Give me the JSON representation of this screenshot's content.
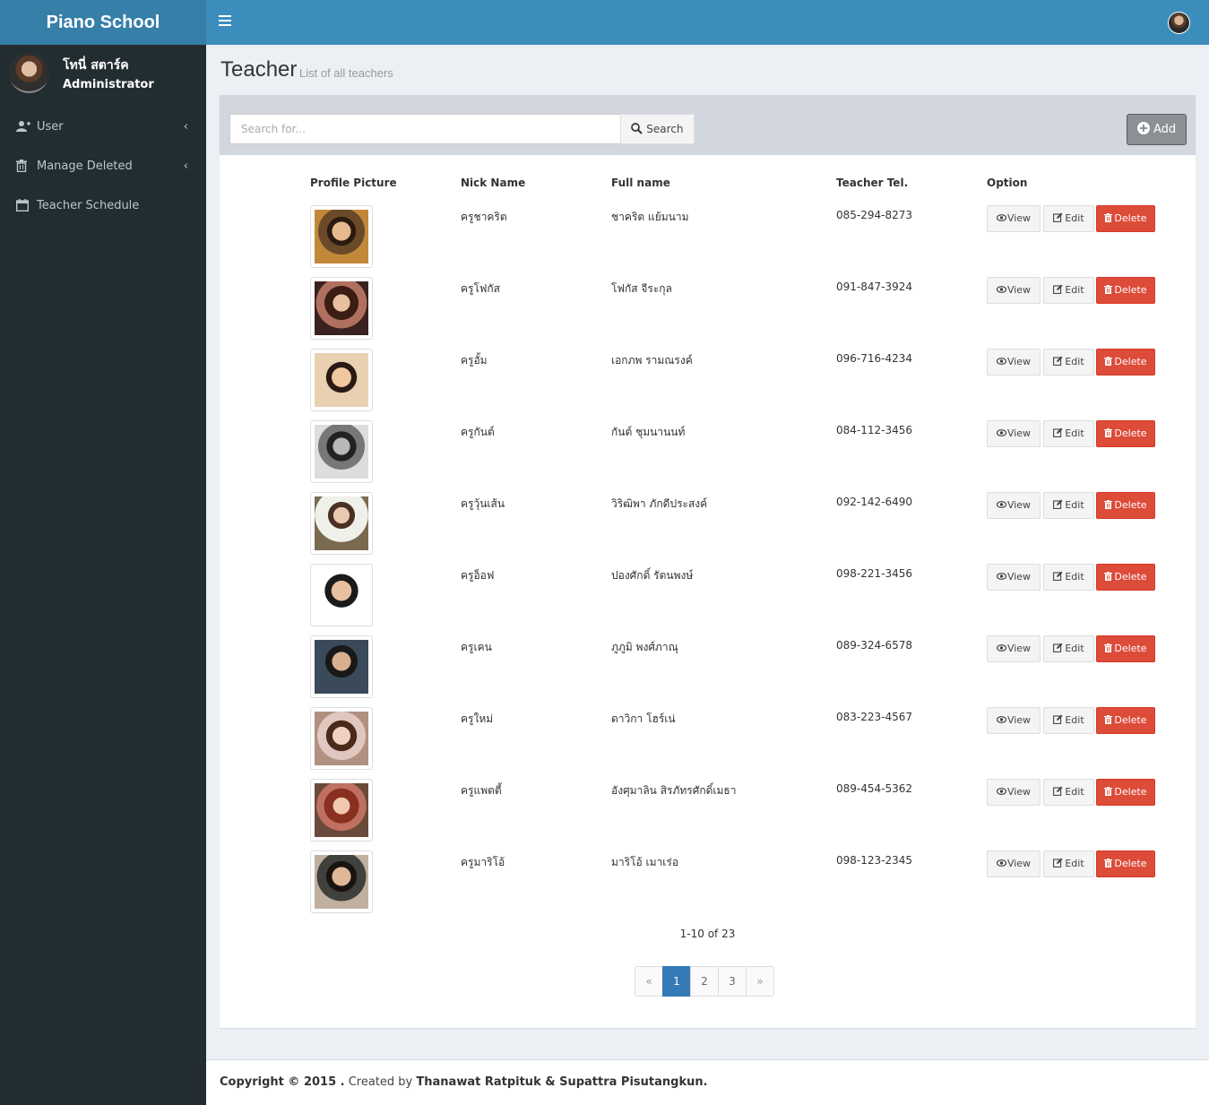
{
  "app": {
    "title": "Piano School"
  },
  "user": {
    "name": "โทนี่ สตาร์ค",
    "role": "Administrator"
  },
  "sidebar": {
    "items": [
      {
        "label": "User",
        "icon": "user-plus-icon",
        "has_submenu": true
      },
      {
        "label": "Manage Deleted",
        "icon": "trash-icon",
        "has_submenu": true
      },
      {
        "label": "Teacher Schedule",
        "icon": "calendar-icon",
        "has_submenu": false
      }
    ]
  },
  "page": {
    "title": "Teacher",
    "subtitle": "List of all teachers"
  },
  "search": {
    "placeholder": "Search for...",
    "button_label": "Search",
    "add_label": "Add"
  },
  "table": {
    "columns": [
      "Profile Picture",
      "Nick Name",
      "Full name",
      "Teacher Tel.",
      "Option"
    ],
    "action_labels": {
      "view": "View",
      "edit": "Edit",
      "delete": "Delete"
    },
    "rows": [
      {
        "nick": "ครูชาคริต",
        "full": "ชาคริต แย้มนาม",
        "tel": "085-294-8273"
      },
      {
        "nick": "ครูโฟกัส",
        "full": "โฟกัส จีระกุล",
        "tel": "091-847-3924"
      },
      {
        "nick": "ครูอั้ม",
        "full": "เอกภพ รามณรงค์",
        "tel": "096-716-4234"
      },
      {
        "nick": "ครูกันต์",
        "full": "กันต์ ชุมนานนท์",
        "tel": "084-112-3456"
      },
      {
        "nick": "ครูวุ้นเส้น",
        "full": "วิริฒิพา ภักดีประสงค์",
        "tel": "092-142-6490"
      },
      {
        "nick": "ครูอ็อฟ",
        "full": "ปองศักดิ์ รัตนพงษ์",
        "tel": "098-221-3456"
      },
      {
        "nick": "ครูเคน",
        "full": "ภูภูมิ พงศ์ภาณุ",
        "tel": "089-324-6578"
      },
      {
        "nick": "ครูใหม่",
        "full": "ดาวิกา โฮร์เน่",
        "tel": "083-223-4567"
      },
      {
        "nick": "ครูแพตตี้",
        "full": "อังศุมาลิน สิรภัทรศักดิ์เมธา",
        "tel": "089-454-5362"
      },
      {
        "nick": "ครูมาริโอ้",
        "full": "มาริโอ้ เมาเร่อ",
        "tel": "098-123-2345"
      }
    ]
  },
  "pagination": {
    "summary": "1-10 of 23",
    "prev": "«",
    "pages": [
      "1",
      "2",
      "3"
    ],
    "next": "»",
    "active": "1"
  },
  "footer": {
    "copyright": "Copyright © 2015 .",
    "created_by": " Created by ",
    "authors": "Thanawat Ratpituk & Supattra Pisutangkun."
  },
  "colors": {
    "header": "#3c8dbc",
    "logo": "#367fa9",
    "sidebar": "#222d32",
    "danger": "#dd4b39",
    "primary": "#337ab7"
  }
}
